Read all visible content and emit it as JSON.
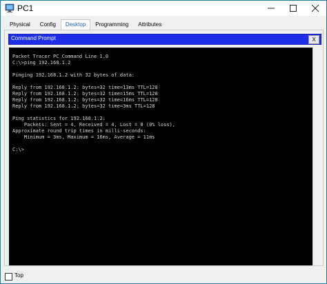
{
  "window": {
    "title": "PC1",
    "icon": "pc-monitor-icon",
    "controls": [
      "minimize",
      "maximize",
      "close"
    ]
  },
  "tabs": [
    {
      "label": "Physical",
      "active": false
    },
    {
      "label": "Config",
      "active": false
    },
    {
      "label": "Desktop",
      "active": true
    },
    {
      "label": "Programming",
      "active": false
    },
    {
      "label": "Attributes",
      "active": false
    }
  ],
  "command_prompt": {
    "title": "Command Prompt",
    "close_label": "X"
  },
  "terminal": {
    "lines": [
      "Packet Tracer PC Command Line 1.0",
      "C:\\>ping 192.168.1.2",
      "",
      "Pinging 192.168.1.2 with 32 bytes of data:",
      "",
      "Reply from 192.168.1.2: bytes=32 time=13ms TTL=128",
      "Reply from 192.168.1.2: bytes=32 time=15ms TTL=128",
      "Reply from 192.168.1.2: bytes=32 time=16ms TTL=128",
      "Reply from 192.168.1.2: bytes=32 time=3ms TTL=128",
      "",
      "Ping statistics for 192.168.1.2:",
      "    Packets: Sent = 4, Received = 4, Lost = 0 (0% loss),",
      "Approximate round trip times in milli-seconds:",
      "    Minimum = 3ms, Maximum = 16ms, Average = 11ms",
      "",
      "C:\\>"
    ]
  },
  "bottom": {
    "top_label": "Top",
    "top_checked": false
  },
  "colors": {
    "window_border": "#1a7fa8",
    "cmd_header": "#1e2ee8",
    "terminal_bg": "#000000",
    "terminal_text": "#d8d8d8",
    "active_tab_text": "#1b60b0"
  }
}
